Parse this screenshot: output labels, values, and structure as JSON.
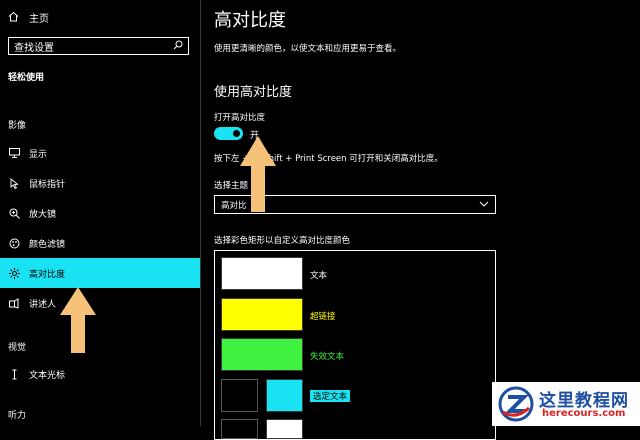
{
  "sidebar": {
    "home_label": "主页",
    "search_placeholder": "查找设置",
    "section_title": "轻松使用",
    "vision_label": "影像",
    "items": [
      {
        "label": "显示"
      },
      {
        "label": "鼠标指针"
      },
      {
        "label": "放大镜"
      },
      {
        "label": "颜色滤镜"
      },
      {
        "label": "高对比度"
      },
      {
        "label": "讲述人"
      }
    ],
    "hearing_label": "视觉",
    "cursor_item": "文本光标",
    "listen_label": "听力"
  },
  "main": {
    "title": "高对比度",
    "description": "使用更清晰的颜色，以使文本和应用更易于查看。",
    "subheading": "使用高对比度",
    "toggle_label": "打开高对比度",
    "toggle_state": "开",
    "shortcut_text": "按下左  + 左 Shift + Print Screen 可打开和关闭高对比度。",
    "theme_label": "选择主题",
    "theme_value": "高对比",
    "color_label": "选择彩色矩形以自定义高对比度颜色",
    "swatches": [
      {
        "label": "文本",
        "color": "#ffffff",
        "label_color": "#ffffff"
      },
      {
        "label": "超链接",
        "color": "#ffff00",
        "label_color": "#ffff00"
      },
      {
        "label": "失效文本",
        "color": "#3ff23f",
        "label_color": "#3ff23f"
      },
      {
        "label": "选定文本",
        "color": "#19e3f2",
        "label_color": "#000000",
        "bg_color": "#000000"
      }
    ]
  },
  "colors": {
    "accent": "#19e3f2",
    "arrow": "#f6c27a"
  },
  "watermark": {
    "line1": "这里教程网",
    "line2": "herecours.com"
  }
}
